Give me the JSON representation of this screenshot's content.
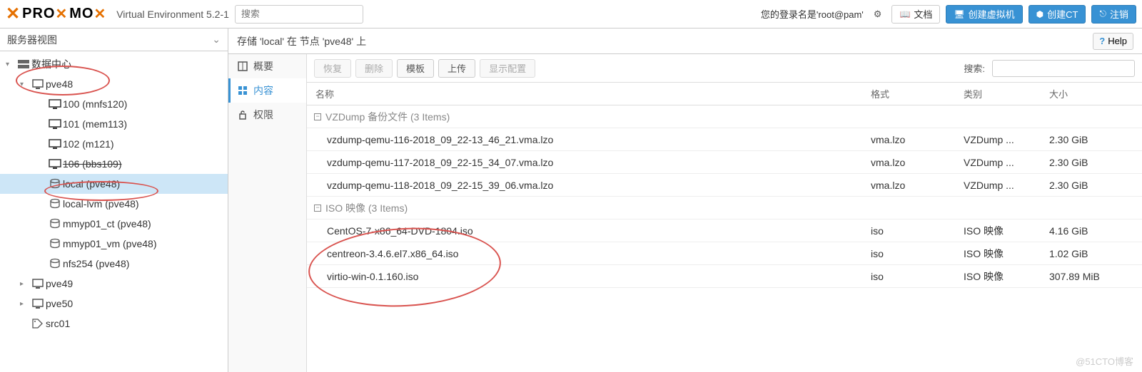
{
  "header": {
    "brand_pre": "PRO",
    "brand_mid": "MO",
    "version": "Virtual Environment 5.2-1",
    "search_placeholder": "搜索",
    "login_prefix": "您的登录名是",
    "login_user": "'root@pam'",
    "docs": "文档",
    "create_vm": "创建虚拟机",
    "create_ct": "创建CT",
    "logout": "注销"
  },
  "sidebar": {
    "view_label": "服务器视图",
    "tree": [
      {
        "label": "数据中心",
        "indent": 0,
        "icon": "server",
        "arrow": "▾"
      },
      {
        "label": "pve48",
        "indent": 1,
        "icon": "node",
        "arrow": "▾"
      },
      {
        "label": "100 (mnfs120)",
        "indent": 2,
        "icon": "vm"
      },
      {
        "label": "101 (mem113)",
        "indent": 2,
        "icon": "vm"
      },
      {
        "label": "102 (m121)",
        "indent": 2,
        "icon": "vm"
      },
      {
        "label": "106 (bbs109)",
        "indent": 2,
        "icon": "vm",
        "strike": true
      },
      {
        "label": "local (pve48)",
        "indent": 2,
        "icon": "storage",
        "selected": true
      },
      {
        "label": "local-lvm (pve48)",
        "indent": 2,
        "icon": "storage"
      },
      {
        "label": "mmyp01_ct (pve48)",
        "indent": 2,
        "icon": "storage"
      },
      {
        "label": "mmyp01_vm (pve48)",
        "indent": 2,
        "icon": "storage"
      },
      {
        "label": "nfs254 (pve48)",
        "indent": 2,
        "icon": "storage"
      },
      {
        "label": "pve49",
        "indent": 1,
        "icon": "node",
        "arrow": "▸"
      },
      {
        "label": "pve50",
        "indent": 1,
        "icon": "node",
        "arrow": "▸"
      },
      {
        "label": "src01",
        "indent": 1,
        "icon": "tag"
      }
    ]
  },
  "content": {
    "crumb": "存储 'local' 在 节点 'pve48' 上",
    "help": "Help",
    "subnav": [
      {
        "label": "概要",
        "icon": "book"
      },
      {
        "label": "内容",
        "icon": "grid",
        "active": true
      },
      {
        "label": "权限",
        "icon": "lock"
      }
    ],
    "toolbar": {
      "restore": "恢复",
      "delete": "删除",
      "template": "模板",
      "upload": "上传",
      "showcfg": "显示配置",
      "search_label": "搜索:"
    },
    "columns": {
      "name": "名称",
      "format": "格式",
      "type": "类别",
      "size": "大小"
    },
    "groups": [
      {
        "title": "VZDump 备份文件 (3 Items)",
        "rows": [
          {
            "name": "vzdump-qemu-116-2018_09_22-13_46_21.vma.lzo",
            "format": "vma.lzo",
            "type": "VZDump ...",
            "size": "2.30 GiB"
          },
          {
            "name": "vzdump-qemu-117-2018_09_22-15_34_07.vma.lzo",
            "format": "vma.lzo",
            "type": "VZDump ...",
            "size": "2.30 GiB"
          },
          {
            "name": "vzdump-qemu-118-2018_09_22-15_39_06.vma.lzo",
            "format": "vma.lzo",
            "type": "VZDump ...",
            "size": "2.30 GiB"
          }
        ]
      },
      {
        "title": "ISO 映像 (3 Items)",
        "rows": [
          {
            "name": "CentOS-7-x86_64-DVD-1804.iso",
            "format": "iso",
            "type": "ISO 映像",
            "size": "4.16 GiB"
          },
          {
            "name": "centreon-3.4.6.el7.x86_64.iso",
            "format": "iso",
            "type": "ISO 映像",
            "size": "1.02 GiB"
          },
          {
            "name": "virtio-win-0.1.160.iso",
            "format": "iso",
            "type": "ISO 映像",
            "size": "307.89 MiB"
          }
        ]
      }
    ]
  },
  "watermark": "@51CTO博客"
}
